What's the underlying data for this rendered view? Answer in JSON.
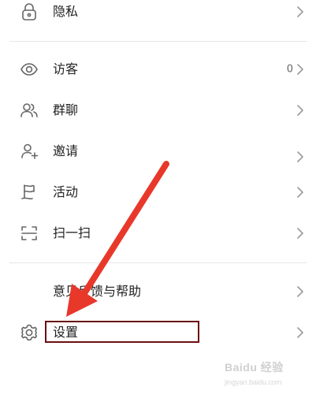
{
  "menu": {
    "privacy": {
      "label": "隐私",
      "icon": "lock-icon"
    },
    "visitors": {
      "label": "访客",
      "count": "0",
      "icon": "eye-icon"
    },
    "group_chat": {
      "label": "群聊",
      "icon": "group-users-icon"
    },
    "invite": {
      "label": "邀请",
      "icon": "add-user-icon"
    },
    "activity": {
      "label": "活动",
      "icon": "flag-icon"
    },
    "scan": {
      "label": "扫一扫",
      "icon": "scan-icon"
    },
    "feedback": {
      "label": "意见反馈与帮助"
    },
    "settings": {
      "label": "设置",
      "icon": "gear-icon"
    }
  },
  "annotation": {
    "arrow_color": "#e8382a",
    "box_color": "#6b0f0f"
  },
  "watermark": {
    "brand": "Baidu 经验",
    "url": "jingyan.baidu.com"
  },
  "colors": {
    "icon": "#666666",
    "chevron": "#999999",
    "divider": "#e6e6e6"
  }
}
